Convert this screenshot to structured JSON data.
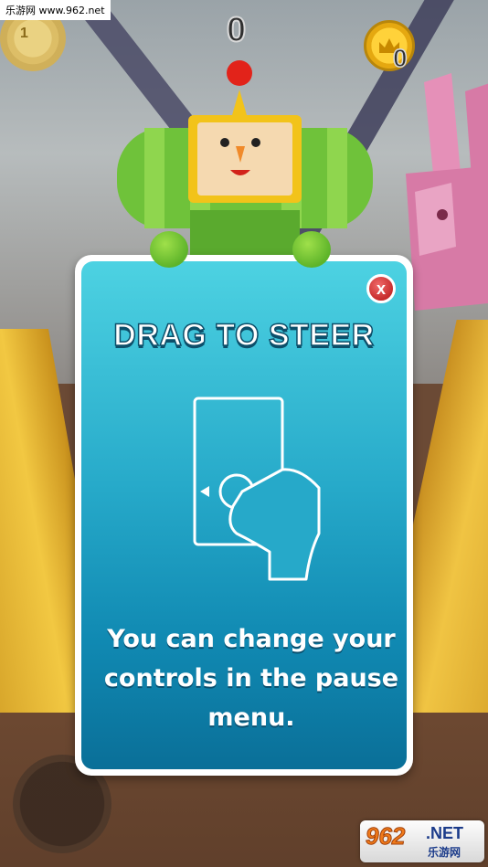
{
  "watermark": {
    "text": "乐游网 www.962.net"
  },
  "hud": {
    "sun_count": "1",
    "score": "0",
    "coin_count": "0"
  },
  "dialog": {
    "title": "DRAG TO STEER",
    "close_label": "x",
    "message": "You can change your controls in the pause menu."
  },
  "logo": {
    "brand": "962",
    "suffix": ".NET",
    "subtitle": "乐游网"
  },
  "colors": {
    "dialog_top": "#4dd2e2",
    "dialog_bottom": "#0a6f98",
    "close_button": "#d63a3a",
    "prince_green": "#6fc23a",
    "coin_gold": "#ffd23a"
  },
  "icons": [
    "crown-icon",
    "close-icon",
    "drag-gesture-icon"
  ]
}
